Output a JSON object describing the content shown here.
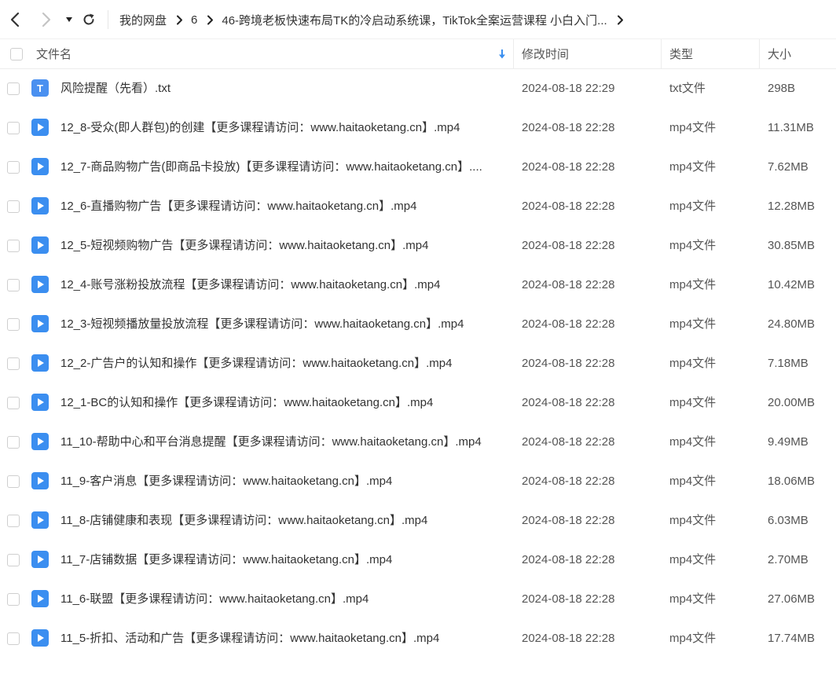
{
  "breadcrumb": {
    "items": [
      "我的网盘",
      "6",
      "46-跨境老板快速布局TK的冷启动系统课，TikTok全案运营课程 小白入门..."
    ]
  },
  "header": {
    "filename": "文件名",
    "modified": "修改时间",
    "type": "类型",
    "size": "大小"
  },
  "colors": {
    "accent": "#3a8ff0",
    "txt_icon": "#4a90f0",
    "video_icon": "#3b8ef0"
  },
  "files": [
    {
      "icon": "txt-file-icon",
      "name": "风险提醒（先看）.txt",
      "date": "2024-08-18 22:29",
      "type": "txt文件",
      "size": "298B"
    },
    {
      "icon": "video-file-icon",
      "name": "12_8-受众(即人群包)的创建【更多课程请访问：www.haitaoketang.cn】.mp4",
      "date": "2024-08-18 22:28",
      "type": "mp4文件",
      "size": "11.31MB"
    },
    {
      "icon": "video-file-icon",
      "name": "12_7-商品购物广告(即商品卡投放)【更多课程请访问：www.haitaoketang.cn】....",
      "date": "2024-08-18 22:28",
      "type": "mp4文件",
      "size": "7.62MB"
    },
    {
      "icon": "video-file-icon",
      "name": "12_6-直播购物广告【更多课程请访问：www.haitaoketang.cn】.mp4",
      "date": "2024-08-18 22:28",
      "type": "mp4文件",
      "size": "12.28MB"
    },
    {
      "icon": "video-file-icon",
      "name": "12_5-短视频购物广告【更多课程请访问：www.haitaoketang.cn】.mp4",
      "date": "2024-08-18 22:28",
      "type": "mp4文件",
      "size": "30.85MB"
    },
    {
      "icon": "video-file-icon",
      "name": "12_4-账号涨粉投放流程【更多课程请访问：www.haitaoketang.cn】.mp4",
      "date": "2024-08-18 22:28",
      "type": "mp4文件",
      "size": "10.42MB"
    },
    {
      "icon": "video-file-icon",
      "name": "12_3-短视频播放量投放流程【更多课程请访问：www.haitaoketang.cn】.mp4",
      "date": "2024-08-18 22:28",
      "type": "mp4文件",
      "size": "24.80MB"
    },
    {
      "icon": "video-file-icon",
      "name": "12_2-广告户的认知和操作【更多课程请访问：www.haitaoketang.cn】.mp4",
      "date": "2024-08-18 22:28",
      "type": "mp4文件",
      "size": "7.18MB"
    },
    {
      "icon": "video-file-icon",
      "name": "12_1-BC的认知和操作【更多课程请访问：www.haitaoketang.cn】.mp4",
      "date": "2024-08-18 22:28",
      "type": "mp4文件",
      "size": "20.00MB"
    },
    {
      "icon": "video-file-icon",
      "name": "11_10-帮助中心和平台消息提醒【更多课程请访问：www.haitaoketang.cn】.mp4",
      "date": "2024-08-18 22:28",
      "type": "mp4文件",
      "size": "9.49MB"
    },
    {
      "icon": "video-file-icon",
      "name": "11_9-客户消息【更多课程请访问：www.haitaoketang.cn】.mp4",
      "date": "2024-08-18 22:28",
      "type": "mp4文件",
      "size": "18.06MB"
    },
    {
      "icon": "video-file-icon",
      "name": "11_8-店铺健康和表现【更多课程请访问：www.haitaoketang.cn】.mp4",
      "date": "2024-08-18 22:28",
      "type": "mp4文件",
      "size": "6.03MB"
    },
    {
      "icon": "video-file-icon",
      "name": "11_7-店铺数据【更多课程请访问：www.haitaoketang.cn】.mp4",
      "date": "2024-08-18 22:28",
      "type": "mp4文件",
      "size": "2.70MB"
    },
    {
      "icon": "video-file-icon",
      "name": "11_6-联盟【更多课程请访问：www.haitaoketang.cn】.mp4",
      "date": "2024-08-18 22:28",
      "type": "mp4文件",
      "size": "27.06MB"
    },
    {
      "icon": "video-file-icon",
      "name": "11_5-折扣、活动和广告【更多课程请访问：www.haitaoketang.cn】.mp4",
      "date": "2024-08-18 22:28",
      "type": "mp4文件",
      "size": "17.74MB"
    }
  ]
}
